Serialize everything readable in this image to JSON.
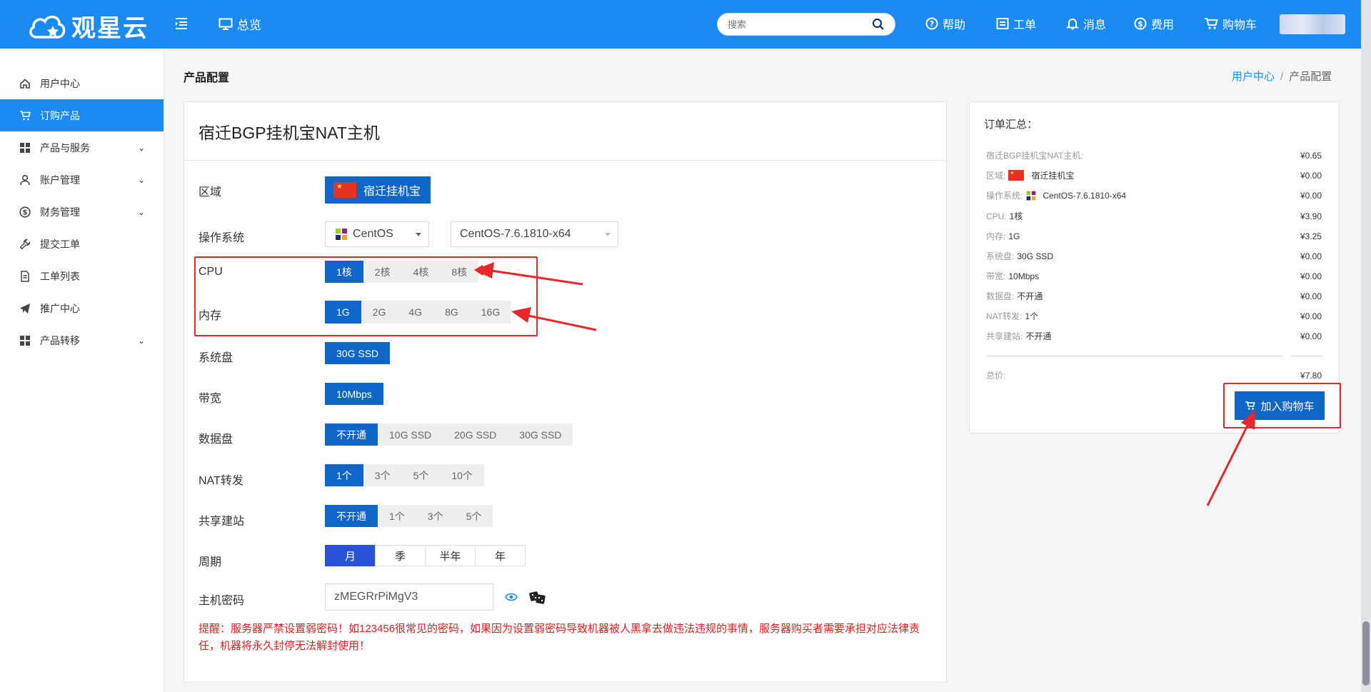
{
  "brand": {
    "name": "观星云"
  },
  "topbar": {
    "overview": "总览",
    "search_placeholder": "搜索",
    "nav": {
      "help": "帮助",
      "ticket": "工单",
      "message": "消息",
      "fee": "费用",
      "cart": "购物车"
    }
  },
  "sidebar": {
    "items": [
      {
        "label": "用户中心",
        "icon": "home-icon"
      },
      {
        "label": "订购产品",
        "icon": "cart-icon",
        "active": true
      },
      {
        "label": "产品与服务",
        "icon": "grid-icon",
        "expandable": true
      },
      {
        "label": "账户管理",
        "icon": "user-icon",
        "expandable": true
      },
      {
        "label": "财务管理",
        "icon": "dollar-icon",
        "expandable": true
      },
      {
        "label": "提交工单",
        "icon": "wrench-icon"
      },
      {
        "label": "工单列表",
        "icon": "document-icon"
      },
      {
        "label": "推广中心",
        "icon": "paper-plane-icon"
      },
      {
        "label": "产品转移",
        "icon": "grid-icon",
        "expandable": true
      }
    ]
  },
  "page": {
    "title": "产品配置",
    "breadcrumb": {
      "home": "用户中心",
      "sep": "/",
      "current": "产品配置"
    }
  },
  "config": {
    "product_name": "宿迁BGP挂机宝NAT主机",
    "region": {
      "label": "区域",
      "value": "宿迁挂机宝"
    },
    "os": {
      "label": "操作系统",
      "family": "CentOS",
      "version": "CentOS-7.6.1810-x64"
    },
    "cpu": {
      "label": "CPU",
      "options": [
        "1核",
        "2核",
        "4核",
        "8核"
      ],
      "selected": 0
    },
    "memory": {
      "label": "内存",
      "options": [
        "1G",
        "2G",
        "4G",
        "8G",
        "16G"
      ],
      "selected": 0
    },
    "system_disk": {
      "label": "系统盘",
      "options": [
        "30G SSD"
      ],
      "selected": 0
    },
    "bandwidth": {
      "label": "带宽",
      "options": [
        "10Mbps"
      ],
      "selected": 0
    },
    "data_disk": {
      "label": "数据盘",
      "options": [
        "不开通",
        "10G SSD",
        "20G SSD",
        "30G SSD"
      ],
      "selected": 0
    },
    "nat": {
      "label": "NAT转发",
      "options": [
        "1个",
        "3个",
        "5个",
        "10个"
      ],
      "selected": 0
    },
    "shared_site": {
      "label": "共享建站",
      "options": [
        "不开通",
        "1个",
        "3个",
        "5个"
      ],
      "selected": 0
    },
    "period": {
      "label": "周期",
      "options": [
        "月",
        "季",
        "半年",
        "年"
      ],
      "selected": 0
    },
    "password": {
      "label": "主机密码",
      "value": "zMEGRrPiMgV3"
    },
    "warning": "提醒：服务器严禁设置弱密码！如123456很常见的密码，如果因为设置弱密码导致机器被人黑拿去做违法违规的事情，服务器购买者需要承担对应法律责任，机器将永久封停无法解封使用！"
  },
  "summary": {
    "title": "订单汇总：",
    "rows": [
      {
        "key": "宿迁BGP挂机宝NAT主机:",
        "value": "",
        "price": "¥0.65"
      },
      {
        "key": "区域:",
        "value": "宿迁挂机宝",
        "price": "¥0.00",
        "icon": "china-flag-icon"
      },
      {
        "key": "操作系统:",
        "value": "CentOS-7.6.1810-x64",
        "price": "¥0.00",
        "icon": "centos-icon"
      },
      {
        "key": "CPU:",
        "value": "1核",
        "price": "¥3.90"
      },
      {
        "key": "内存:",
        "value": "1G",
        "price": "¥3.25"
      },
      {
        "key": "系统盘:",
        "value": "30G SSD",
        "price": "¥0.00"
      },
      {
        "key": "带宽:",
        "value": "10Mbps",
        "price": "¥0.00"
      },
      {
        "key": "数据盘:",
        "value": "不开通",
        "price": "¥0.00"
      },
      {
        "key": "NAT转发:",
        "value": "1个",
        "price": "¥0.00"
      },
      {
        "key": "共享建站:",
        "value": "不开通",
        "price": "¥0.00"
      }
    ],
    "total_label": "总价:",
    "total": "¥7.80",
    "cart_button": "加入购物车"
  },
  "colors": {
    "brand_blue": "#1a8af5",
    "selected_blue": "#0f66c6",
    "period_blue": "#2a52d9",
    "annotation_red": "#e8262b",
    "warning_red": "#e0201c"
  }
}
